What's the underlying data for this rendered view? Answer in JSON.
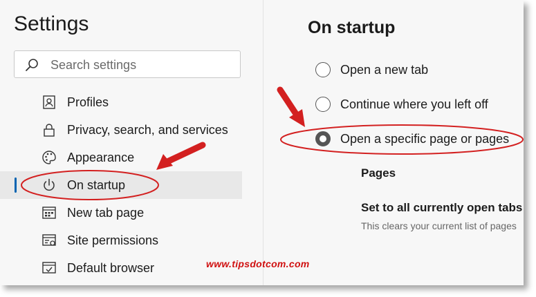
{
  "settings": {
    "title": "Settings",
    "search_placeholder": "Search settings"
  },
  "nav": {
    "items": [
      {
        "label": "Profiles",
        "icon": "profile-icon"
      },
      {
        "label": "Privacy, search, and services",
        "icon": "lock-icon"
      },
      {
        "label": "Appearance",
        "icon": "palette-icon"
      },
      {
        "label": "On startup",
        "icon": "power-icon",
        "active": true
      },
      {
        "label": "New tab page",
        "icon": "new-tab-icon"
      },
      {
        "label": "Site permissions",
        "icon": "site-permissions-icon"
      },
      {
        "label": "Default browser",
        "icon": "default-browser-icon"
      }
    ]
  },
  "startup": {
    "title": "On startup",
    "options": [
      {
        "label": "Open a new tab",
        "checked": false
      },
      {
        "label": "Continue where you left off",
        "checked": false
      },
      {
        "label": "Open a specific page or pages",
        "checked": true
      }
    ],
    "pages_heading": "Pages",
    "set_heading": "Set to all currently open tabs",
    "set_desc": "This clears your current list of pages"
  },
  "watermark": "www.tipsdotcom.com",
  "colors": {
    "accent": "#0063b1",
    "annotation_red": "#d32020"
  }
}
